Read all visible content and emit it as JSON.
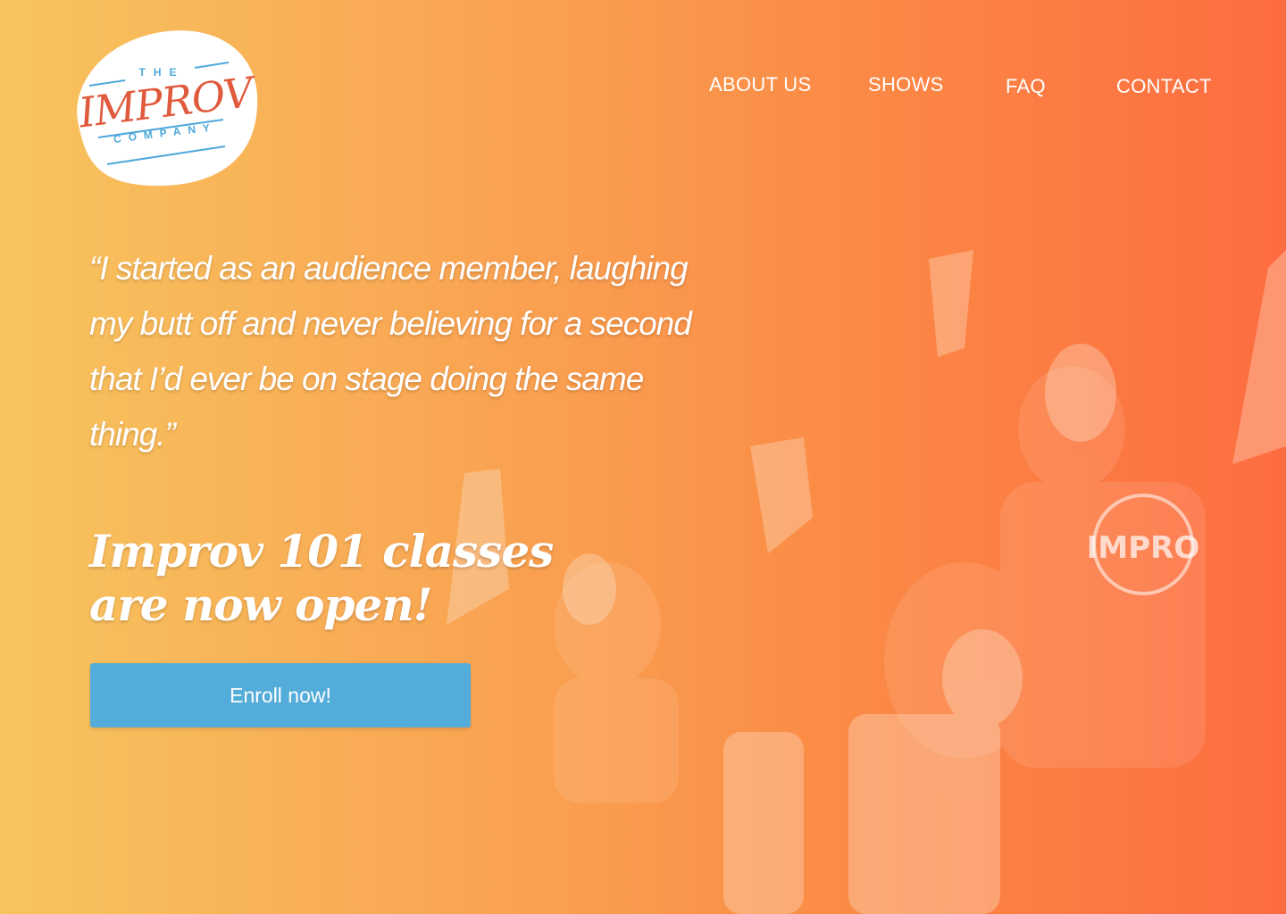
{
  "logo": {
    "the": "THE",
    "main": "IMPROV",
    "company": "COMPANY"
  },
  "nav": {
    "items": [
      "ABOUT US",
      "SHOWS",
      "FAQ",
      "CONTACT"
    ]
  },
  "hero": {
    "quote": "“I started as an audience member, laughing my butt off and never believing for a second that I’d ever be on stage doing the same thing.”",
    "headline_line1": "Improv 101 classes",
    "headline_line2": "are now open!",
    "cta_label": "Enroll now!"
  },
  "colors": {
    "gradient_start": "#f8c45e",
    "gradient_end": "#fd6c40",
    "accent_blue": "#53acd9",
    "logo_red": "#e05a3d"
  }
}
